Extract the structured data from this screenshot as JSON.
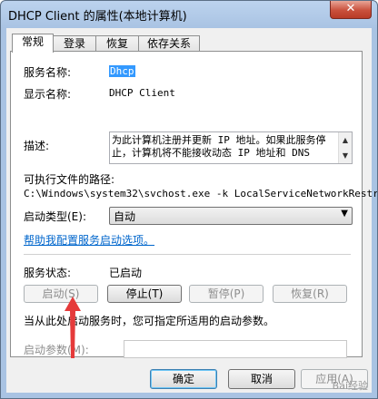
{
  "window": {
    "title": "DHCP Client 的属性(本地计算机)",
    "close_glyph": "✕"
  },
  "tabs": [
    "常规",
    "登录",
    "恢复",
    "依存关系"
  ],
  "general": {
    "service_name_label": "服务名称:",
    "service_name_value": "Dhcp",
    "display_name_label": "显示名称:",
    "display_name_value": "DHCP Client",
    "description_label": "描述:",
    "description_text": "为此计算机注册并更新 IP 地址。如果此服务停止，计算机将不能接收动态 IP 地址和 DNS",
    "exe_path_label": "可执行文件的路径:",
    "exe_path_value": "C:\\Windows\\system32\\svchost.exe -k LocalServiceNetworkRestri",
    "startup_type_label": "启动类型(E):",
    "startup_type_value": "自动",
    "help_link": "帮助我配置服务启动选项。",
    "service_status_label": "服务状态:",
    "service_status_value": "已启动",
    "buttons": {
      "start": "启动(S)",
      "stop": "停止(T)",
      "pause": "暂停(P)",
      "resume": "恢复(R)"
    },
    "hint_text": "当从此处启动服务时，您可指定所适用的启动参数。",
    "start_params_label": "启动参数(M):",
    "start_params_value": ""
  },
  "dialog_buttons": {
    "ok": "确定",
    "cancel": "取消",
    "apply": "应用(A)"
  },
  "annotation_color": "#e53a3a",
  "watermark": "Bai经验"
}
